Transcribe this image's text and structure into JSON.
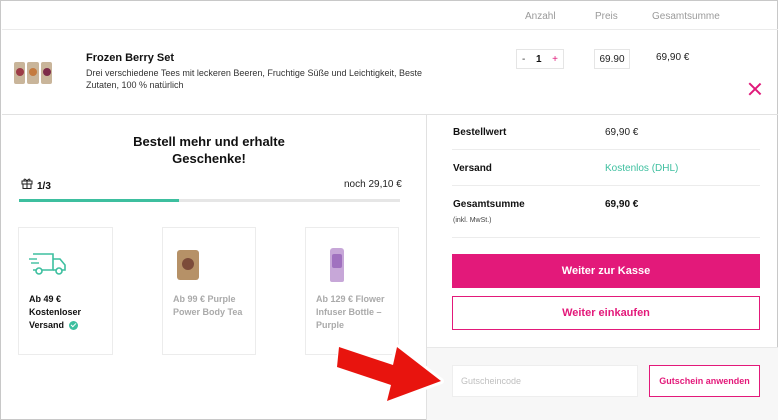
{
  "header": {
    "qty": "Anzahl",
    "price": "Preis",
    "total": "Gesamtsumme"
  },
  "product": {
    "title": "Frozen Berry Set",
    "description": "Drei verschiedene Tees mit leckeren Beeren,  Fruchtige Süße und Leichtigkeit,  Beste Zutaten, 100 % natürlich",
    "stepper": {
      "minus": "-",
      "quantity": "1",
      "plus": "+"
    },
    "unit_price": "69.90",
    "line_total": "69,90 €",
    "remove_icon": "close-icon"
  },
  "gifts": {
    "promo_title": "Bestell mehr und erhalte Geschenke!",
    "progress_label": "1/3",
    "progress_fraction": 0.42,
    "remaining": "noch 29,10 €",
    "tiers": [
      {
        "label": "Ab 49 € Kostenloser Versand",
        "icon": "delivery-truck-icon",
        "unlocked": true
      },
      {
        "label": "Ab 99 € Purple Power Body Tea",
        "icon": "tea-package-icon",
        "unlocked": false
      },
      {
        "label": "Ab 129 € Flower Infuser Bottle – Purple",
        "icon": "bottle-icon",
        "unlocked": false
      }
    ]
  },
  "summary": {
    "subtotal_label": "Bestellwert",
    "subtotal_value": "69,90 €",
    "shipping_label": "Versand",
    "shipping_value": "Kostenlos (DHL)",
    "total_label": "Gesamtsumme",
    "total_value": "69,90 €",
    "tax_note": "(inkl. MwSt.)"
  },
  "actions": {
    "checkout": "Weiter zur Kasse",
    "continue": "Weiter einkaufen",
    "coupon_placeholder": "Gutscheincode",
    "coupon_apply": "Gutschein anwenden"
  },
  "colors": {
    "accent": "#e3197a",
    "success": "#3dbf9f",
    "annotation": "#e8140e"
  }
}
